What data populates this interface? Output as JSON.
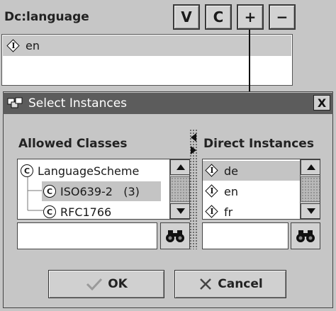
{
  "slot": {
    "title": "Dc:language",
    "buttons": {
      "v": "V",
      "c": "C",
      "add": "+",
      "remove": "−"
    },
    "values": [
      {
        "icon": "instance-icon",
        "label": "en"
      }
    ]
  },
  "dialog": {
    "title": "Select Instances",
    "close_label": "X",
    "allowed_classes": {
      "label": "Allowed Classes",
      "tree": [
        {
          "label": "LanguageScheme",
          "level": 0
        },
        {
          "label": "ISO639-2   (3)",
          "level": 1,
          "selected": true
        },
        {
          "label": "RFC1766",
          "level": 1
        }
      ]
    },
    "direct_instances": {
      "label": "Direct Instances",
      "items": [
        {
          "label": "de",
          "selected": true
        },
        {
          "label": "en"
        },
        {
          "label": "fr"
        }
      ]
    },
    "buttons": {
      "ok": "OK",
      "cancel": "Cancel"
    }
  },
  "icons": {
    "instance": "instance-icon",
    "class": "class-icon",
    "find": "binoculars-icon",
    "ok": "checkmark-icon",
    "cancel": "x-icon"
  },
  "colors": {
    "background": "#c6c6c6",
    "titlebar": "#5c5c5c",
    "selection": "#c9c9c9",
    "list_bg": "#ffffff"
  }
}
